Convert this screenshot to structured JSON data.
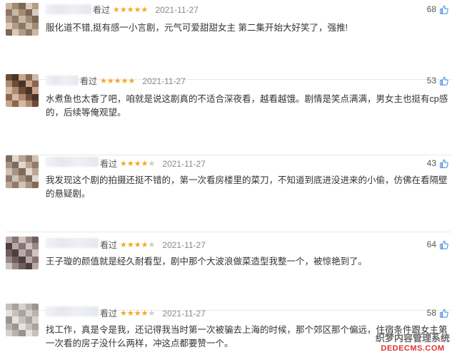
{
  "reviews": [
    {
      "seen": "看过",
      "stars": 5,
      "date": "2021-11-27",
      "likes": "68",
      "text": "服化道不错,挺有感一小言剧，元气可爱甜甜女主 第二集开始大好笑了，强推!"
    },
    {
      "seen": "看过",
      "stars": 5,
      "date": "2021-11-27",
      "likes": "53",
      "text": "水煮鱼也太香了吧，咱就是说这剧真的不适合深夜看，越看越饿。剧情是笑点满满，男女主也挺有cp感的，后续等俺观望。"
    },
    {
      "seen": "看过",
      "stars": 4,
      "date": "2021-11-27",
      "likes": "43",
      "text": "我发现这个剧的拍摄还挺不错的，第一次看房楼里的菜刀，不知道到底进没进来的小偷，仿佛在看隔壁的悬疑剧。"
    },
    {
      "seen": "看过",
      "stars": 4,
      "date": "2021-11-27",
      "likes": "64",
      "text": "王子璇的颜值就是经久耐看型，剧中那个大波浪做菜造型我整一个，被惊艳到了。"
    },
    {
      "seen": "看过",
      "stars": 4,
      "date": "2021-11-27",
      "likes": "58",
      "text": "找工作，真是令是我，还记得我当时第一次被骗去上海的时候，那个郊区那个偏远，住宿条件跟女主第一次看的房子没什么两样，冲这点都要赞一个。"
    }
  ],
  "icons": {
    "star": "star-icon",
    "like": "thumbs-up-icon"
  },
  "colors": {
    "star_on": "#f5a623",
    "star_off": "#cccccc",
    "like_icon": "#4a90e2"
  },
  "watermark": {
    "line1": "织梦内容管理系统",
    "line2": "DEDECMS.COM"
  }
}
